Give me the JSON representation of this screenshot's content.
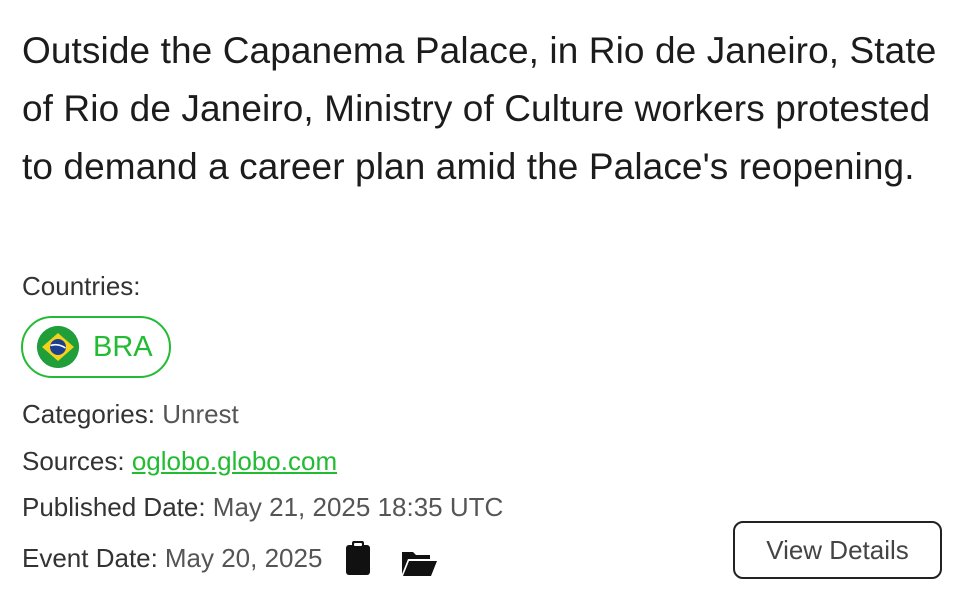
{
  "event": {
    "headline": "Outside the Capanema Palace, in Rio de Janeiro, State of Rio de Janeiro, Ministry of Culture workers protested to demand a career plan amid the Palace's reopening.",
    "countries_label": "Countries:",
    "countries": [
      {
        "code": "BRA",
        "flag_icon": "brazil-flag-icon"
      }
    ],
    "categories_label": "Categories:",
    "categories_value": "Unrest",
    "sources_label": "Sources:",
    "sources_value": "oglobo.globo.com",
    "published_label": "Published Date:",
    "published_value": "May 21, 2025 18:35 UTC",
    "event_date_label": "Event Date:",
    "event_date_value": "May 20, 2025",
    "icons": [
      "clipboard-icon",
      "folder-open-icon"
    ],
    "view_details_label": "View Details"
  },
  "colors": {
    "accent": "#22bb33",
    "text": "#1c1c1c",
    "muted": "#555555",
    "border": "#222222"
  }
}
